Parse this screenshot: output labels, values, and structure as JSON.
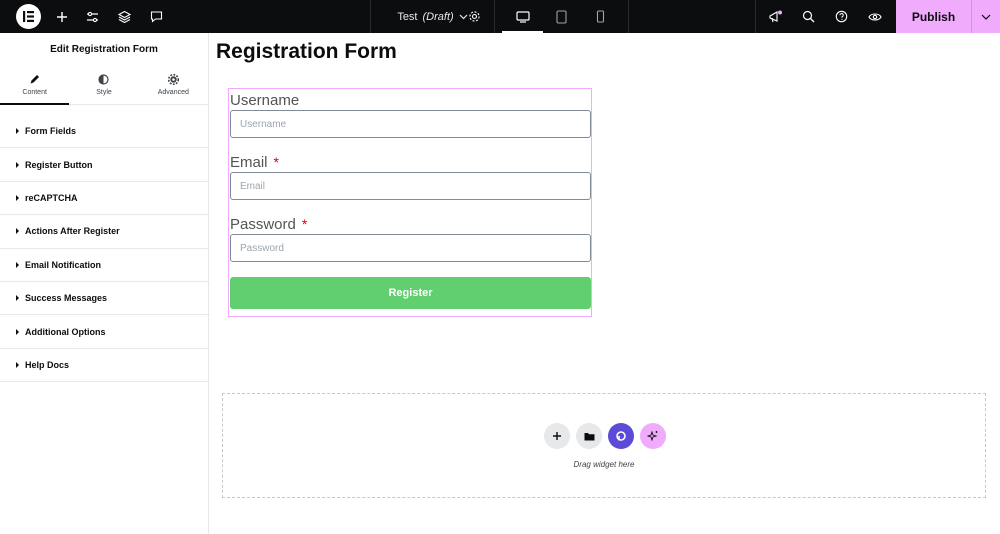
{
  "topbar": {
    "doc_name": "Test",
    "doc_status": "(Draft)",
    "publish_label": "Publish",
    "icons": [
      "elementor-logo-icon",
      "plus-icon",
      "sliders-icon",
      "layers-icon",
      "comment-icon",
      "gear-icon",
      "desktop-icon",
      "tablet-icon",
      "mobile-icon",
      "megaphone-icon",
      "search-icon",
      "help-icon",
      "eye-icon",
      "chevron-down-icon"
    ]
  },
  "panel": {
    "title": "Edit Registration Form",
    "tabs": [
      {
        "label": "Content",
        "icon": "pencil-icon"
      },
      {
        "label": "Style",
        "icon": "half-circle-icon"
      },
      {
        "label": "Advanced",
        "icon": "gear-icon"
      }
    ],
    "sections": [
      "Form Fields",
      "Register Button",
      "reCAPTCHA",
      "Actions After Register",
      "Email Notification",
      "Success Messages",
      "Additional Options",
      "Help Docs"
    ]
  },
  "canvas": {
    "page_title": "Registration Form",
    "form": {
      "fields": [
        {
          "label": "Username",
          "placeholder": "Username",
          "required": false
        },
        {
          "label": "Email",
          "placeholder": "Email",
          "required": true
        },
        {
          "label": "Password",
          "placeholder": "Password",
          "required": true
        }
      ],
      "required_mark": "*",
      "button_label": "Register",
      "button_color": "#61ce70"
    },
    "dropzone": {
      "text": "Drag widget here"
    }
  },
  "colors": {
    "accent": "#f0abfc",
    "topbar_bg": "#0c0d0e",
    "purple": "#5b4bd6"
  }
}
